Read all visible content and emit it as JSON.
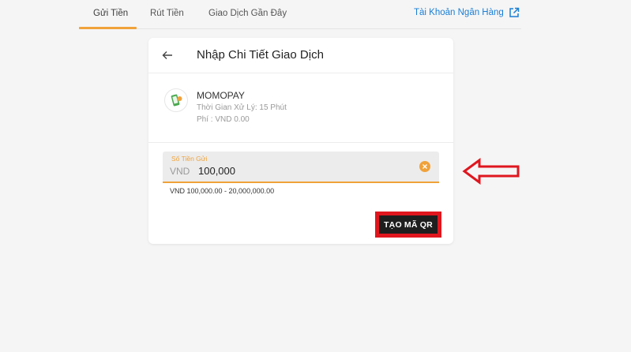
{
  "tabs": [
    {
      "label": "Gửi Tiền"
    },
    {
      "label": "Rút Tiền"
    },
    {
      "label": "Giao Dịch Gần Đây"
    }
  ],
  "bank_link": {
    "label": "Tài Khoản Ngân Hàng",
    "icon": "external-link-icon"
  },
  "card": {
    "title": "Nhập Chi Tiết Giao Dịch",
    "back_icon": "back-arrow-icon"
  },
  "method": {
    "name": "MOMOPAY",
    "processing_time": "Thời Gian Xử Lý: 15 Phút",
    "fee": "Phí : VND 0.00",
    "icon": "momopay-logo-icon"
  },
  "amount": {
    "label": "Số Tiền Gửi",
    "currency": "VND",
    "value": "100,000",
    "range_hint": "VND 100,000.00 - 20,000,000.00",
    "clear_icon": "clear-icon"
  },
  "submit": {
    "label": "TẠO MÃ QR"
  },
  "colors": {
    "accent": "#f0a23a",
    "link": "#1a7fd4",
    "highlight": "#e0161e",
    "button": "#1e1e1e"
  }
}
